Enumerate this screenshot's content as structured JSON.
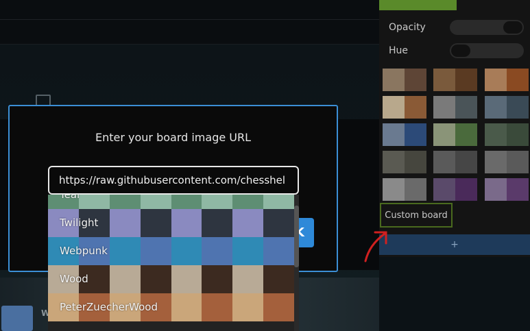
{
  "modal": {
    "title": "Enter your board image URL",
    "url_value": "https://raw.githubusercontent.com/chesshel",
    "ok_label": "K"
  },
  "board_options": [
    {
      "label": "Teal",
      "colors": [
        "#5e8e73",
        "#8fb8a4"
      ]
    },
    {
      "label": "Twilight",
      "colors": [
        "#8a8ac0",
        "#2e3540"
      ]
    },
    {
      "label": "Webpunk",
      "colors": [
        "#2f8ab5",
        "#4f74b0"
      ]
    },
    {
      "label": "Wood",
      "colors": [
        "#b8aa96",
        "#3c2a20"
      ]
    },
    {
      "label": "PeterZuecherWood",
      "colors": [
        "#caa67a",
        "#a4603c"
      ]
    }
  ],
  "settings": {
    "opacity_label": "Opacity",
    "hue_label": "Hue",
    "opacity_value": 1,
    "hue_value": 0,
    "custom_board_label": "Custom board",
    "add_label": "+",
    "swatches": [
      [
        "#8a7660",
        "#5e4536"
      ],
      [
        "#7a5a3c",
        "#5a3a22"
      ],
      [
        "#a87c58",
        "#8a4a22"
      ],
      [
        "#b8a88c",
        "#8a5a36"
      ],
      [
        "#7a7a7a",
        "#4a5458"
      ],
      [
        "#5a6a78",
        "#3a4a56"
      ],
      [
        "#6a7a90",
        "#2c4a78"
      ],
      [
        "#8a9478",
        "#4a6a3c"
      ],
      [
        "#4a5a4a",
        "#3a4a3a"
      ],
      [
        "#5a5a52",
        "#46463e"
      ],
      [
        "#5a5a5a",
        "#464646"
      ],
      [
        "#6a6a6a",
        "#5a5a5a"
      ],
      [
        "#8a8a8a",
        "#6a6a6a"
      ],
      [
        "#5a4a6a",
        "#4a2a5a"
      ],
      [
        "#7a6a8a",
        "#5a3a6a"
      ]
    ]
  },
  "background": {
    "chip_label": "W"
  }
}
